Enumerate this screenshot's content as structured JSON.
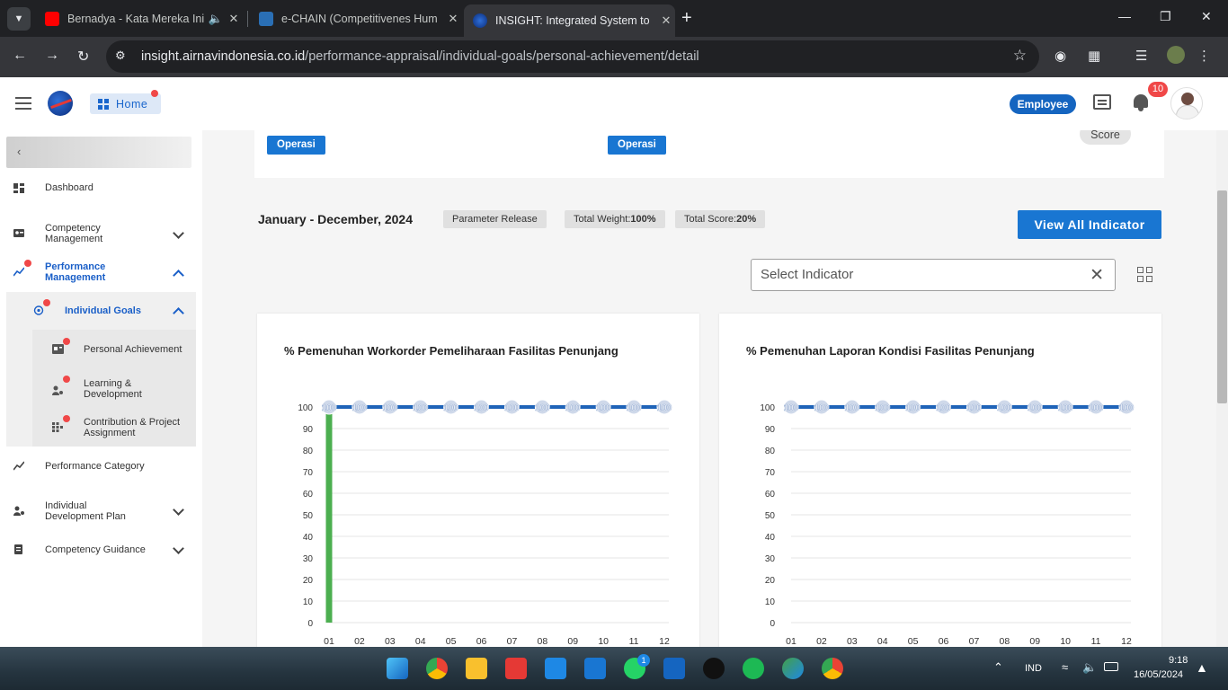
{
  "browser": {
    "tabs": [
      {
        "title": "Bernadya - Kata Mereka Ini",
        "active": false
      },
      {
        "title": "e-CHAIN (Competitivenes Hum",
        "active": false
      },
      {
        "title": "INSIGHT: Integrated System to",
        "active": true
      }
    ],
    "url_host": "insight.airnavindonesia.co.id",
    "url_path": "/performance-appraisal/individual-goals/personal-achievement/detail"
  },
  "header": {
    "home_label": "Home",
    "role_badge": "Employee",
    "notification_count": "10"
  },
  "sidebar": {
    "items": [
      {
        "label": "Dashboard"
      },
      {
        "label": "Competency Management"
      },
      {
        "label": "Performance Management"
      },
      {
        "label": "Individual Goals"
      },
      {
        "label": "Personal Achievement"
      },
      {
        "label": "Learning & Development"
      },
      {
        "label": "Contribution & Project Assignment"
      },
      {
        "label": "Performance Category"
      },
      {
        "label": "Individual Development Plan"
      },
      {
        "label": "Competency Guidance"
      }
    ]
  },
  "main": {
    "unit_chip_1": "Operasi",
    "unit_chip_2": "Operasi",
    "score_chip": "Score",
    "period": "January - December, 2024",
    "param_release": "Parameter Release",
    "total_weight_label": "Total Weight:",
    "total_weight_value": "100%",
    "total_score_label": "Total Score:",
    "total_score_value": "20%",
    "view_all_button": "View All Indicator",
    "select_placeholder": "Select Indicator"
  },
  "chart_data": [
    {
      "type": "bar",
      "title": "% Pemenuhan Workorder Pemeliharaan Fasilitas Penunjang",
      "categories": [
        "01",
        "02",
        "03",
        "04",
        "05",
        "06",
        "07",
        "08",
        "09",
        "10",
        "11",
        "12"
      ],
      "ylim": [
        0,
        100
      ],
      "yticks": [
        0,
        10,
        20,
        30,
        40,
        50,
        60,
        70,
        80,
        90,
        100
      ],
      "series": [
        {
          "type": "bar",
          "values": [
            100,
            0,
            0,
            0,
            0,
            0,
            0,
            0,
            0,
            0,
            0,
            0
          ],
          "color": "#4caf50"
        },
        {
          "type": "line",
          "values": [
            100,
            100,
            100,
            100,
            100,
            100,
            100,
            100,
            100,
            100,
            100,
            100
          ],
          "color": "#1e63b8"
        }
      ]
    },
    {
      "type": "line",
      "title": "% Pemenuhan Laporan Kondisi Fasilitas Penunjang",
      "categories": [
        "01",
        "02",
        "03",
        "04",
        "05",
        "06",
        "07",
        "08",
        "09",
        "10",
        "11",
        "12"
      ],
      "ylim": [
        0,
        100
      ],
      "yticks": [
        0,
        10,
        20,
        30,
        40,
        50,
        60,
        70,
        80,
        90,
        100
      ],
      "series": [
        {
          "type": "line",
          "values": [
            100,
            100,
            100,
            100,
            100,
            100,
            100,
            100,
            100,
            100,
            100,
            100
          ],
          "color": "#1e63b8"
        }
      ]
    }
  ],
  "taskbar": {
    "language": "IND",
    "time": "9:18",
    "date": "16/05/2024",
    "whatsapp_badge": "1"
  }
}
